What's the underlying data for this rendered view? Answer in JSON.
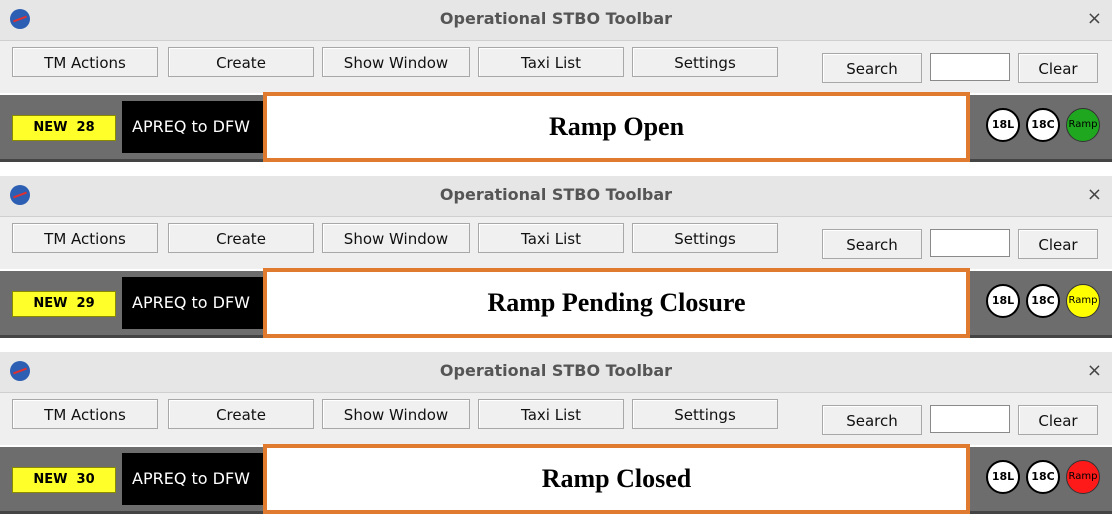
{
  "toolbars": [
    {
      "window_title": "Operational STBO Toolbar",
      "close_glyph": "×",
      "buttons": {
        "tm_actions": "TM Actions",
        "create": "Create",
        "show_window": "Show Window",
        "taxi_list": "Taxi List",
        "settings": "Settings",
        "search": "Search",
        "clear": "Clear"
      },
      "search_value": "",
      "new_badge": "NEW  28",
      "apreq": "APREQ to DFW",
      "ramp_status": "Ramp Open",
      "runways": [
        "18L",
        "18C"
      ],
      "ramp_label": "Ramp",
      "ramp_color": "#1fa81f"
    },
    {
      "window_title": "Operational STBO Toolbar",
      "close_glyph": "×",
      "buttons": {
        "tm_actions": "TM Actions",
        "create": "Create",
        "show_window": "Show Window",
        "taxi_list": "Taxi List",
        "settings": "Settings",
        "search": "Search",
        "clear": "Clear"
      },
      "search_value": "",
      "new_badge": "NEW  29",
      "apreq": "APREQ to DFW",
      "ramp_status": "Ramp Pending Closure",
      "runways": [
        "18L",
        "18C"
      ],
      "ramp_label": "Ramp",
      "ramp_color": "#ffff00"
    },
    {
      "window_title": "Operational STBO Toolbar",
      "close_glyph": "×",
      "buttons": {
        "tm_actions": "TM Actions",
        "create": "Create",
        "show_window": "Show Window",
        "taxi_list": "Taxi List",
        "settings": "Settings",
        "search": "Search",
        "clear": "Clear"
      },
      "search_value": "",
      "new_badge": "NEW  30",
      "apreq": "APREQ to DFW",
      "ramp_status": "Ramp Closed",
      "runways": [
        "18L",
        "18C"
      ],
      "ramp_label": "Ramp",
      "ramp_color": "#ff1a1a"
    }
  ]
}
